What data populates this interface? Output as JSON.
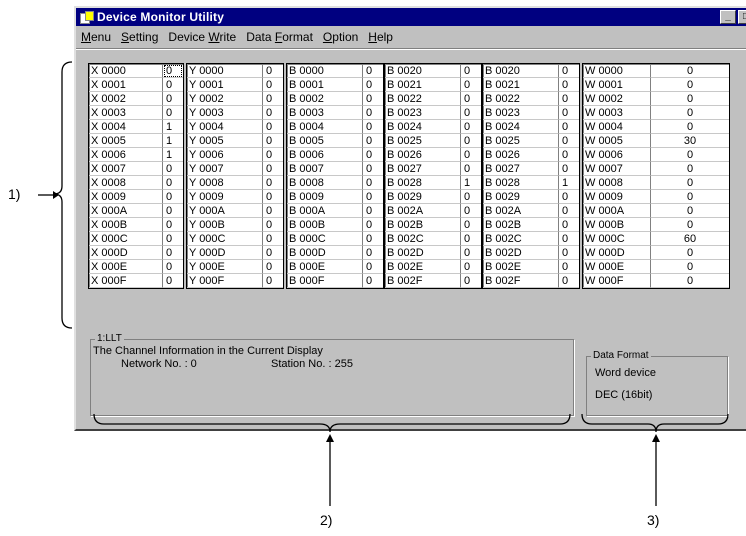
{
  "window": {
    "title": "Device Monitor Utility"
  },
  "menu": [
    {
      "pre": "",
      "u": "M",
      "post": "enu"
    },
    {
      "pre": "",
      "u": "S",
      "post": "etting"
    },
    {
      "pre": "Device ",
      "u": "W",
      "post": "rite"
    },
    {
      "pre": "Data ",
      "u": "F",
      "post": "ormat"
    },
    {
      "pre": "",
      "u": "O",
      "post": "ption"
    },
    {
      "pre": "",
      "u": "H",
      "post": "elp"
    }
  ],
  "columns": [
    {
      "names": [
        "X 0000",
        "X 0001",
        "X 0002",
        "X 0003",
        "X 0004",
        "X 0005",
        "X 0006",
        "X 0007",
        "X 0008",
        "X 0009",
        "X 000A",
        "X 000B",
        "X 000C",
        "X 000D",
        "X 000E",
        "X 000F"
      ],
      "values": [
        "0",
        "0",
        "0",
        "0",
        "1",
        "1",
        "1",
        "0",
        "0",
        "0",
        "0",
        "0",
        "0",
        "0",
        "0",
        "0"
      ]
    },
    {
      "names": [
        "Y 0000",
        "Y 0001",
        "Y 0002",
        "Y 0003",
        "Y 0004",
        "Y 0005",
        "Y 0006",
        "Y 0007",
        "Y 0008",
        "Y 0009",
        "Y 000A",
        "Y 000B",
        "Y 000C",
        "Y 000D",
        "Y 000E",
        "Y 000F"
      ],
      "values": [
        "0",
        "0",
        "0",
        "0",
        "0",
        "0",
        "0",
        "0",
        "0",
        "0",
        "0",
        "0",
        "0",
        "0",
        "0",
        "0"
      ]
    },
    {
      "names": [
        "B 0000",
        "B 0001",
        "B 0002",
        "B 0003",
        "B 0004",
        "B 0005",
        "B 0006",
        "B 0007",
        "B 0008",
        "B 0009",
        "B 000A",
        "B 000B",
        "B 000C",
        "B 000D",
        "B 000E",
        "B 000F"
      ],
      "values": [
        "0",
        "0",
        "0",
        "0",
        "0",
        "0",
        "0",
        "0",
        "0",
        "0",
        "0",
        "0",
        "0",
        "0",
        "0",
        "0"
      ]
    },
    {
      "names": [
        "B 0020",
        "B 0021",
        "B 0022",
        "B 0023",
        "B 0024",
        "B 0025",
        "B 0026",
        "B 0027",
        "B 0028",
        "B 0029",
        "B 002A",
        "B 002B",
        "B 002C",
        "B 002D",
        "B 002E",
        "B 002F"
      ],
      "values": [
        "0",
        "0",
        "0",
        "0",
        "0",
        "0",
        "0",
        "0",
        "1",
        "0",
        "0",
        "0",
        "0",
        "0",
        "0",
        "0"
      ]
    },
    {
      "names": [
        "B 0020",
        "B 0021",
        "B 0022",
        "B 0023",
        "B 0024",
        "B 0025",
        "B 0026",
        "B 0027",
        "B 0028",
        "B 0029",
        "B 002A",
        "B 002B",
        "B 002C",
        "B 002D",
        "B 002E",
        "B 002F"
      ],
      "values": [
        "0",
        "0",
        "0",
        "0",
        "0",
        "0",
        "0",
        "0",
        "1",
        "0",
        "0",
        "0",
        "0",
        "0",
        "0",
        "0"
      ]
    },
    {
      "names": [
        "W 0000",
        "W 0001",
        "W 0002",
        "W 0003",
        "W 0004",
        "W 0005",
        "W 0006",
        "W 0007",
        "W 0008",
        "W 0009",
        "W 000A",
        "W 000B",
        "W 000C",
        "W 000D",
        "W 000E",
        "W 000F"
      ],
      "values": [
        "0",
        "0",
        "0",
        "0",
        "0",
        "30",
        "0",
        "0",
        "0",
        "0",
        "0",
        "0",
        "60",
        "0",
        "0",
        "0"
      ]
    }
  ],
  "channel": {
    "label": "1:LLT",
    "line1": "The Channel Information in the Current Display",
    "network": "Network No. : 0",
    "station": "Station No. : 255"
  },
  "format": {
    "label": "Data Format",
    "type": "Word device",
    "mode": "DEC (16bit)"
  },
  "annotations": {
    "a1": "1)",
    "a2": "2)",
    "a3": "3)"
  }
}
